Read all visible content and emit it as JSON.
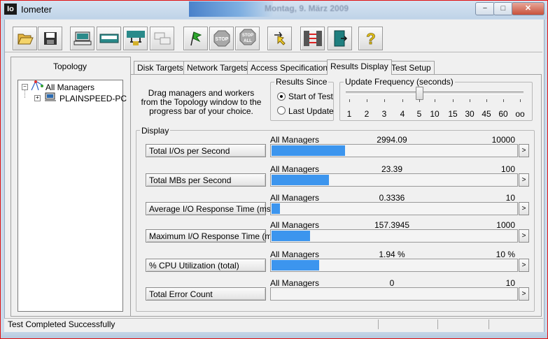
{
  "window": {
    "title": "Iometer",
    "app_icon_text": "Io",
    "background_blurred_text": "Montag, 9. März 2009",
    "controls": {
      "minimize": "−",
      "maximize": "□",
      "close": "✕"
    }
  },
  "toolbar": {
    "buttons": [
      {
        "name": "open-config",
        "icon": "folder-open-icon"
      },
      {
        "name": "save-config",
        "icon": "floppy-disk-icon"
      },
      {
        "name": "start-disk-worker",
        "icon": "disk-worker-icon"
      },
      {
        "name": "start-network-worker",
        "icon": "network-worker-icon"
      },
      {
        "name": "add-manager",
        "icon": "add-manager-icon"
      },
      {
        "name": "copy-worker",
        "icon": "duplicate-worker-icon"
      },
      {
        "name": "start-tests",
        "icon": "green-flag-icon"
      },
      {
        "name": "stop",
        "icon": "stop-sign-icon",
        "label": "STOP"
      },
      {
        "name": "stop-all",
        "icon": "stop-all-icon",
        "label": "STOP ALL"
      },
      {
        "name": "reset-workers",
        "icon": "reset-arrow-icon"
      },
      {
        "name": "reset-managers",
        "icon": "network-connect-icon"
      },
      {
        "name": "exit",
        "icon": "exit-door-icon"
      },
      {
        "name": "about",
        "icon": "question-mark-icon",
        "label": "?"
      }
    ]
  },
  "topology": {
    "title": "Topology",
    "root": {
      "label": "All Managers",
      "expander": "−"
    },
    "child": {
      "label": "PLAINSPEED-PC",
      "expander": "+"
    }
  },
  "tabs": [
    {
      "label": "Disk Targets",
      "active": false
    },
    {
      "label": "Network Targets",
      "active": false
    },
    {
      "label": "Access Specifications",
      "active": false
    },
    {
      "label": "Results Display",
      "active": true
    },
    {
      "label": "Test Setup",
      "active": false
    }
  ],
  "results_display": {
    "instructions": "Drag managers and workers from the Topology window to the progress bar of your choice.",
    "results_since": {
      "label": "Results Since",
      "options": [
        {
          "label": "Start of Test",
          "selected": true
        },
        {
          "label": "Last Update",
          "selected": false
        }
      ]
    },
    "update_frequency": {
      "label": "Update Frequency (seconds)",
      "ticks": [
        "1",
        "2",
        "3",
        "4",
        "5",
        "10",
        "15",
        "30",
        "45",
        "60",
        "oo"
      ],
      "selected": "5"
    },
    "display": {
      "label": "Display",
      "rows": [
        {
          "button": "Total I/Os per Second",
          "source": "All Managers",
          "value": "2994.09",
          "max": "10000",
          "fill": 0.2994
        },
        {
          "button": "Total MBs per Second",
          "source": "All Managers",
          "value": "23.39",
          "max": "100",
          "fill": 0.2339
        },
        {
          "button": "Average I/O Response Time (ms)",
          "source": "All Managers",
          "value": "0.3336",
          "max": "10",
          "fill": 0.0334
        },
        {
          "button": "Maximum I/O Response Time (ms)",
          "source": "All Managers",
          "value": "157.3945",
          "max": "1000",
          "fill": 0.1574
        },
        {
          "button": "% CPU Utilization (total)",
          "source": "All Managers",
          "value": "1.94 %",
          "max": "10 %",
          "fill": 0.194
        },
        {
          "button": "Total Error Count",
          "source": "All Managers",
          "value": "0",
          "max": "10",
          "fill": 0
        }
      ],
      "scroll_glyph": ">"
    }
  },
  "status": {
    "text": "Test Completed Successfully"
  },
  "colors": {
    "bar_fill": "#3c95ee",
    "frame_red": "#e01010"
  }
}
